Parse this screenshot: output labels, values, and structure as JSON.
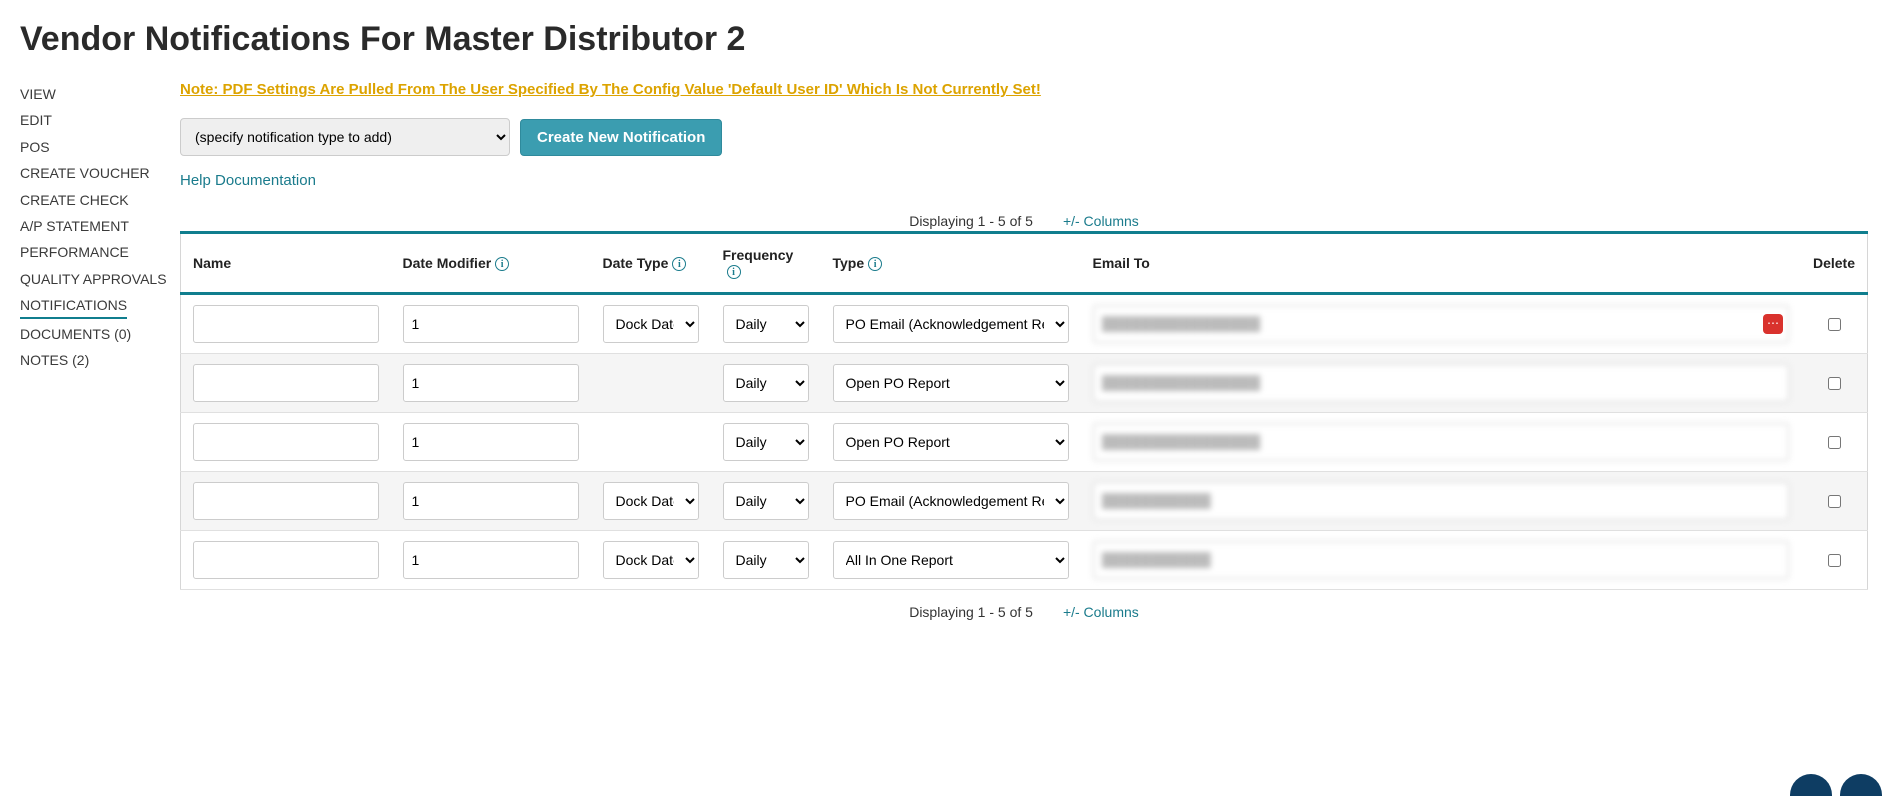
{
  "page_title": "Vendor Notifications For Master Distributor 2",
  "sidebar_items": [
    {
      "label": "VIEW",
      "active": false
    },
    {
      "label": "EDIT",
      "active": false
    },
    {
      "label": "POS",
      "active": false
    },
    {
      "label": "CREATE VOUCHER",
      "active": false
    },
    {
      "label": "CREATE CHECK",
      "active": false
    },
    {
      "label": "A/P STATEMENT",
      "active": false
    },
    {
      "label": "PERFORMANCE",
      "active": false
    },
    {
      "label": "QUALITY APPROVALS",
      "active": false
    },
    {
      "label": "NOTIFICATIONS",
      "active": true
    },
    {
      "label": "DOCUMENTS (0)",
      "active": false
    },
    {
      "label": "NOTES (2)",
      "active": false
    }
  ],
  "warning_text": "Note: PDF Settings Are Pulled From The User Specified By The Config Value 'Default User ID' Which Is Not Currently Set!",
  "add_type_placeholder": "(specify notification type to add)",
  "create_button_label": "Create New Notification",
  "help_link_label": "Help Documentation",
  "displaying_text": "Displaying 1 - 5 of 5",
  "columns_link_label": "+/- Columns",
  "columns": {
    "name": "Name",
    "date_modifier": "Date Modifier",
    "date_type": "Date Type",
    "frequency": "Frequency",
    "type": "Type",
    "email_to": "Email To",
    "delete": "Delete"
  },
  "type_options": [
    "PO Email (Acknowledgement Request)",
    "Open PO Report",
    "All In One Report"
  ],
  "date_type_options": [
    "Dock Date"
  ],
  "frequency_options": [
    "Daily"
  ],
  "rows": [
    {
      "name": "",
      "date_modifier": "1",
      "date_type": "Dock Date",
      "frequency": "Daily",
      "type": "PO Email (Acknowledgement Request)",
      "email_to": "████████████████",
      "show_more": true
    },
    {
      "name": "",
      "date_modifier": "1",
      "date_type": "",
      "frequency": "Daily",
      "type": "Open PO Report",
      "email_to": "████████████████",
      "show_more": false
    },
    {
      "name": "",
      "date_modifier": "1",
      "date_type": "",
      "frequency": "Daily",
      "type": "Open PO Report",
      "email_to": "████████████████",
      "show_more": false
    },
    {
      "name": "",
      "date_modifier": "1",
      "date_type": "Dock Date",
      "frequency": "Daily",
      "type": "PO Email (Acknowledgement Request)",
      "email_to": "███████████",
      "show_more": false
    },
    {
      "name": "",
      "date_modifier": "1",
      "date_type": "Dock Date",
      "frequency": "Daily",
      "type": "All In One Report",
      "email_to": "███████████",
      "show_more": false
    }
  ]
}
